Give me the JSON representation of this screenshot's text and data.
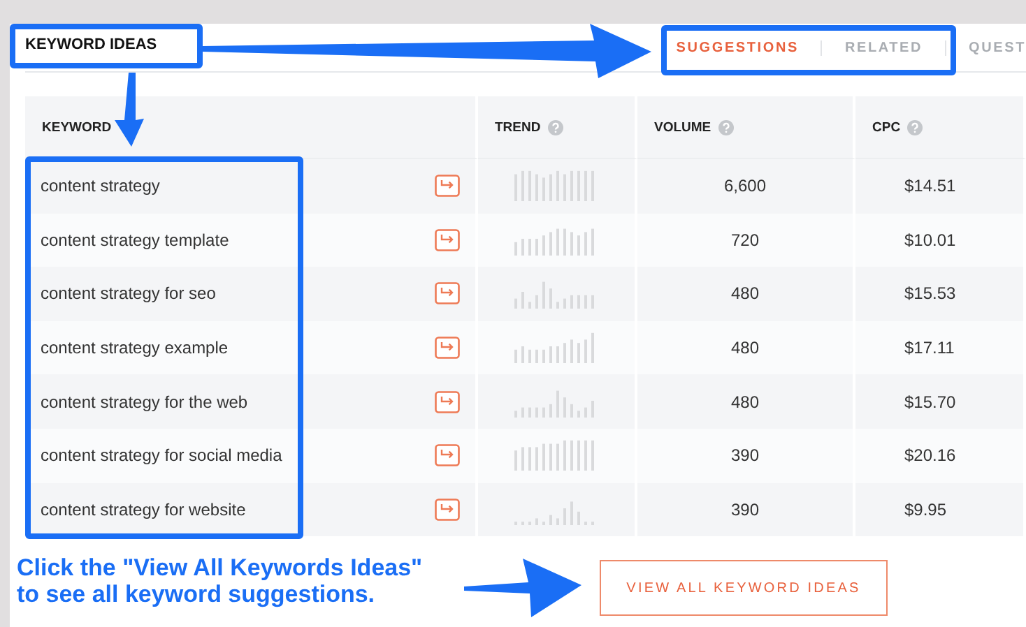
{
  "section_title": "KEYWORD IDEAS",
  "tabs": [
    {
      "label": "SUGGESTIONS",
      "selected": true
    },
    {
      "label": "RELATED",
      "selected": false
    },
    {
      "label": "QUEST",
      "selected": false
    }
  ],
  "table": {
    "columns": [
      {
        "label": "KEYWORD",
        "help": false
      },
      {
        "label": "TREND",
        "help": true
      },
      {
        "label": "VOLUME",
        "help": true
      },
      {
        "label": "CPC",
        "help": true
      }
    ],
    "rows": [
      {
        "keyword": "content strategy",
        "volume": "6,600",
        "cpc": "$14.51"
      },
      {
        "keyword": "content strategy template",
        "volume": "720",
        "cpc": "$10.01"
      },
      {
        "keyword": "content strategy for seo",
        "volume": "480",
        "cpc": "$15.53"
      },
      {
        "keyword": "content strategy example",
        "volume": "480",
        "cpc": "$17.11"
      },
      {
        "keyword": "content strategy for the web",
        "volume": "480",
        "cpc": "$15.70"
      },
      {
        "keyword": "content strategy for social media",
        "volume": "390",
        "cpc": "$20.16"
      },
      {
        "keyword": "content strategy for website",
        "volume": "390",
        "cpc": "$9.95"
      }
    ]
  },
  "button": "VIEW ALL KEYWORD IDEAS",
  "annotation": "Click the \"View All Keywords Ideas\"\nto see all keyword suggestions."
}
